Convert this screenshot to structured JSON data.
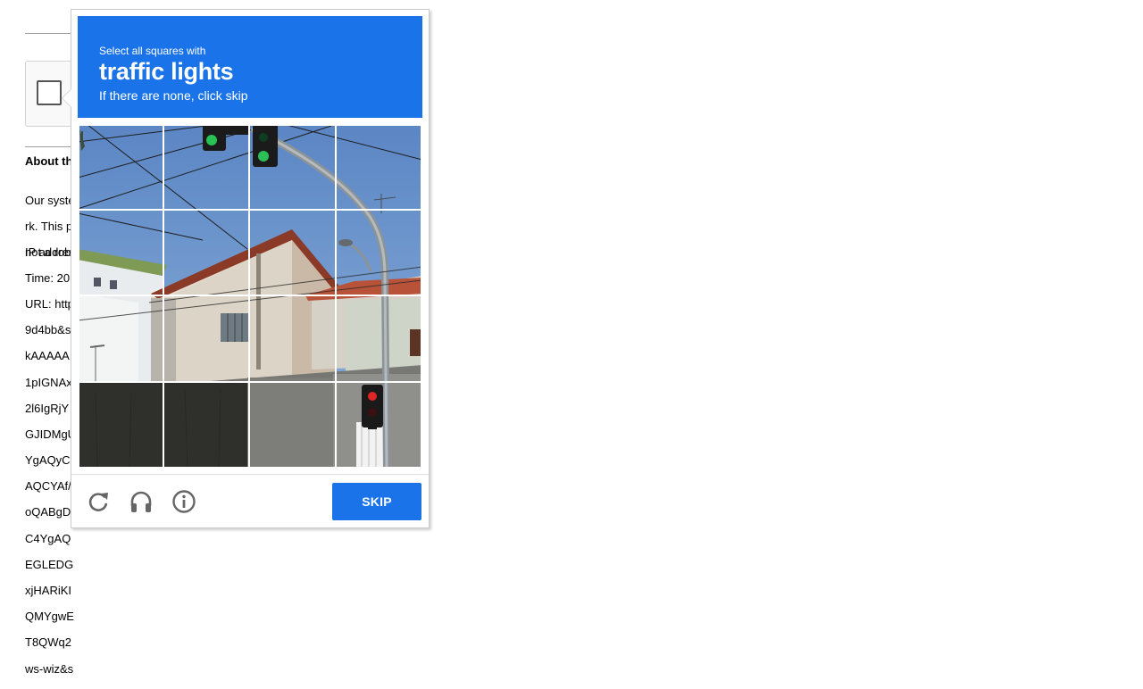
{
  "background_page": {
    "heading": "About th",
    "paragraph_lines": [
      "Our syste",
      "rk. This p",
      "not a robo"
    ],
    "info_lines": [
      "IP addres",
      "Time: 20",
      "URL: http",
      "9d4bb&s",
      "kAAAAA",
      "1pIGNAx",
      "2l6IgRjY",
      "GJIDMgU",
      "YgAQyC",
      "AQCYAf/",
      "oQABgD",
      "C4YgAQ",
      "EGLEDG",
      "xjHARiKI",
      "QMYgwE",
      "T8QWq2",
      "ws-wiz&s"
    ]
  },
  "challenge": {
    "instruction": "Select all squares with",
    "target": "traffic lights",
    "hint": "If there are none, click skip",
    "accent_color": "#1a73e8",
    "grid_size": 4,
    "footer": {
      "reload_icon": "reload-icon",
      "audio_icon": "headphones-icon",
      "info_icon": "info-icon",
      "skip_label": "SKIP"
    }
  }
}
